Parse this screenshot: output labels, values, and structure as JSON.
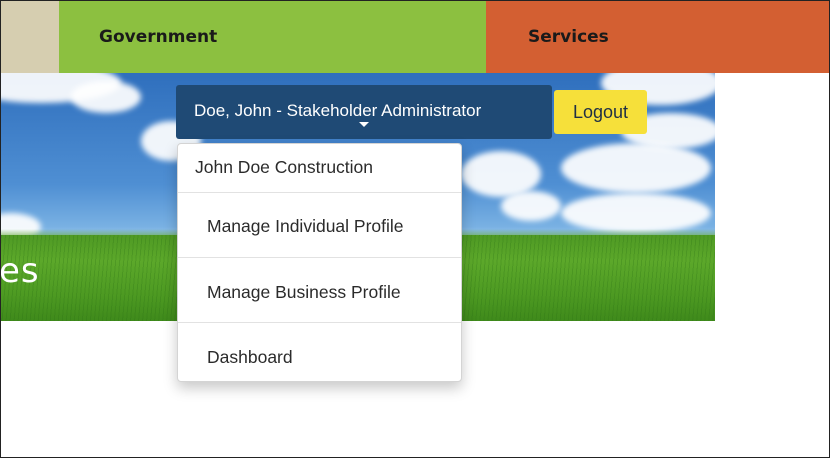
{
  "nav": {
    "tabs": [
      {
        "label": "Government",
        "color": "#8cc040"
      },
      {
        "label": "Services",
        "color": "#d35f32"
      }
    ],
    "stub_color": "#d6ceb0"
  },
  "banner": {
    "text": "es"
  },
  "user_menu": {
    "button_label": "Doe, John - Stakeholder Administrator",
    "button_color": "#1f4a75",
    "logout_label": "Logout",
    "logout_color": "#f6e03a",
    "dropdown": {
      "header": "John Doe Construction",
      "items": [
        {
          "label": "Manage Individual Profile"
        },
        {
          "label": "Manage Business Profile"
        },
        {
          "label": "Dashboard"
        }
      ]
    }
  }
}
